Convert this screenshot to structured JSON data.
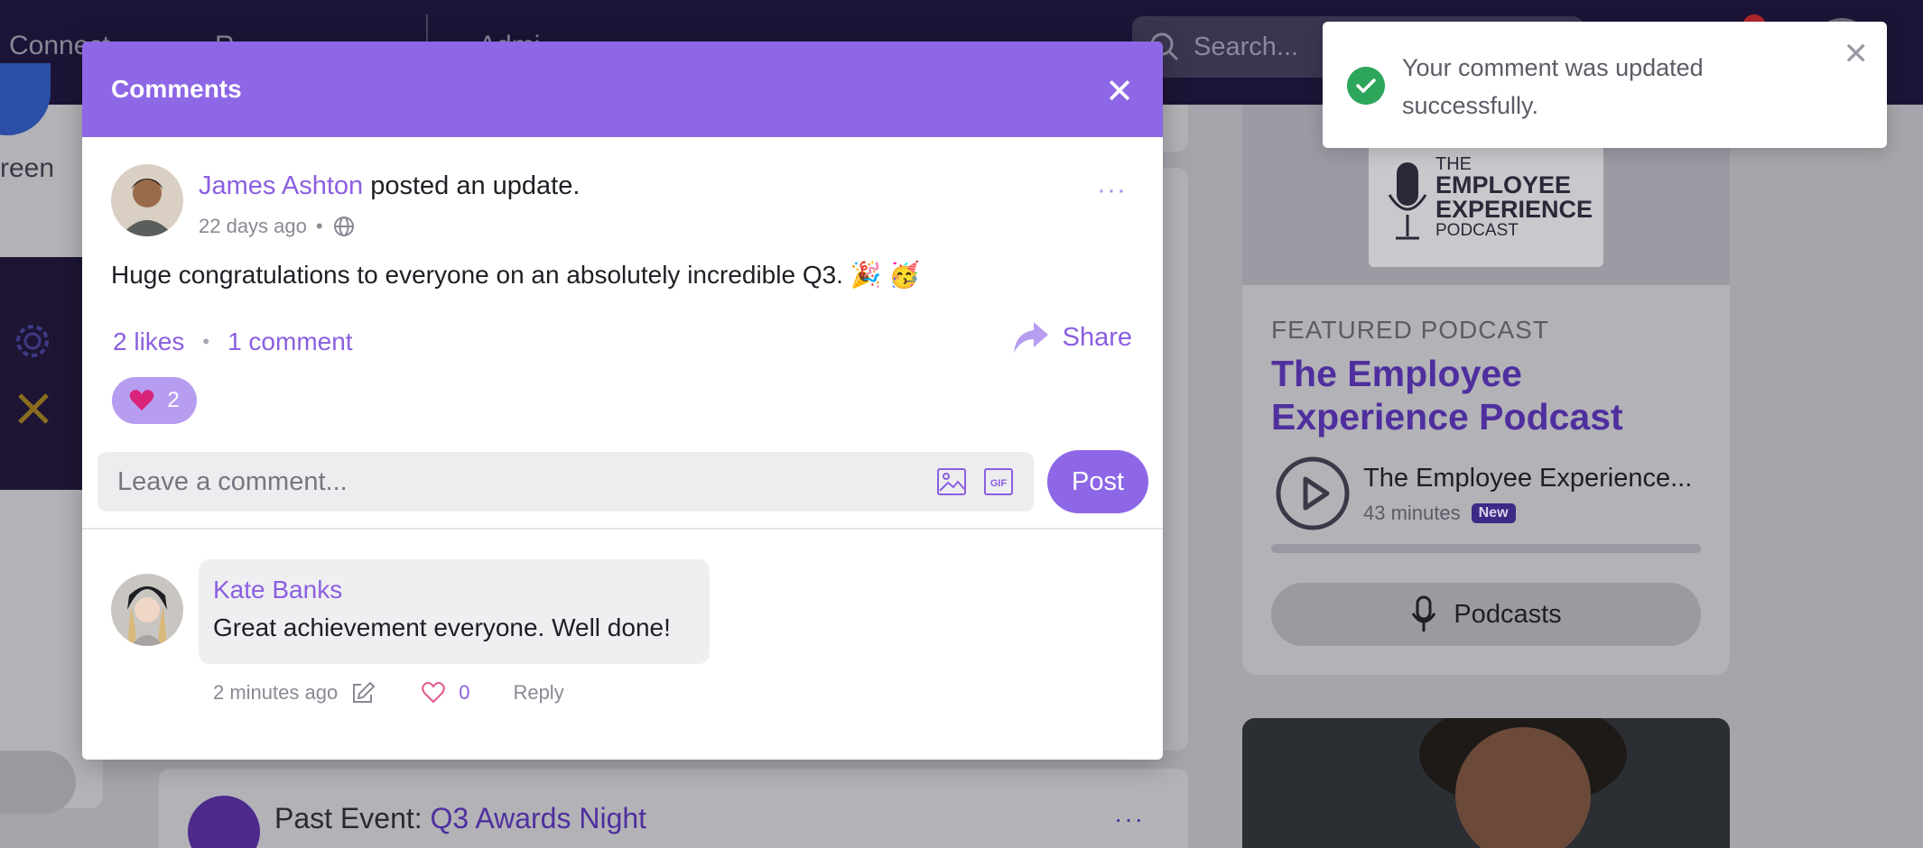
{
  "nav": {
    "items": [
      "Connect",
      "R",
      "Admi"
    ],
    "search_placeholder": "Search..."
  },
  "background": {
    "left_screen_text": "reen",
    "event": {
      "prefix": "Past Event:",
      "name": "Q3 Awards Night"
    },
    "podcast": {
      "logo_the": "THE",
      "logo_line1": "EMPLOYEE",
      "logo_line2": "EXPERIENCE",
      "logo_line3": "PODCAST",
      "eyebrow": "FEATURED PODCAST",
      "title": "The Employee Experience Podcast",
      "episode_title": "The Employee Experience...",
      "duration": "43 minutes",
      "badge": "New",
      "button_label": "Podcasts"
    }
  },
  "modal": {
    "title": "Comments",
    "post": {
      "author": "James Ashton",
      "action": " posted an update.",
      "time": "22 days ago",
      "separator": "•",
      "body": "Huge congratulations to everyone on an absolutely incredible Q3. 🎉 🥳",
      "likes_label": "2 likes",
      "comments_label": "1 comment",
      "dot": "•",
      "share_label": "Share",
      "reaction_count": "2",
      "more": "···"
    },
    "comment_box": {
      "placeholder": "Leave a comment...",
      "post_label": "Post"
    },
    "reply": {
      "author": "Kate Banks",
      "text": "Great achievement everyone. Well done!",
      "time": "2 minutes ago",
      "like_count": "0",
      "reply_label": "Reply"
    }
  },
  "toast": {
    "message": "Your comment was updated successfully."
  },
  "colors": {
    "accent": "#8d67e6",
    "accent_text": "#8b5fe0",
    "success": "#2da65b",
    "nav_bg": "#1c1436"
  }
}
